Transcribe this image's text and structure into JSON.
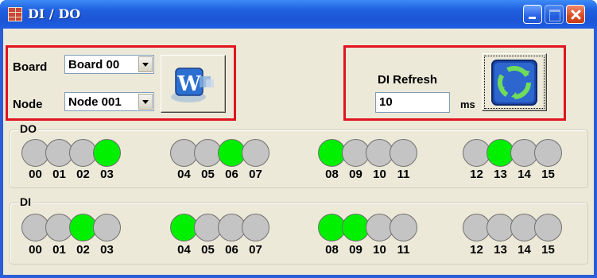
{
  "window": {
    "title": "DI / DO"
  },
  "board": {
    "label": "Board",
    "value": "Board 00"
  },
  "node": {
    "label": "Node",
    "value": "Node 001"
  },
  "refresh": {
    "label": "DI Refresh",
    "value": "10",
    "unit": "ms"
  },
  "do_group": {
    "title": "DO",
    "channels": [
      {
        "label": "00",
        "on": false
      },
      {
        "label": "01",
        "on": false
      },
      {
        "label": "02",
        "on": false
      },
      {
        "label": "03",
        "on": true
      },
      {
        "label": "04",
        "on": false
      },
      {
        "label": "05",
        "on": false
      },
      {
        "label": "06",
        "on": true
      },
      {
        "label": "07",
        "on": false
      },
      {
        "label": "08",
        "on": true
      },
      {
        "label": "09",
        "on": false
      },
      {
        "label": "10",
        "on": false
      },
      {
        "label": "11",
        "on": false
      },
      {
        "label": "12",
        "on": false
      },
      {
        "label": "13",
        "on": true
      },
      {
        "label": "14",
        "on": false
      },
      {
        "label": "15",
        "on": false
      }
    ]
  },
  "di_group": {
    "title": "DI",
    "channels": [
      {
        "label": "00",
        "on": false
      },
      {
        "label": "01",
        "on": false
      },
      {
        "label": "02",
        "on": true
      },
      {
        "label": "03",
        "on": false
      },
      {
        "label": "04",
        "on": true
      },
      {
        "label": "05",
        "on": false
      },
      {
        "label": "06",
        "on": false
      },
      {
        "label": "07",
        "on": false
      },
      {
        "label": "08",
        "on": true
      },
      {
        "label": "09",
        "on": true
      },
      {
        "label": "10",
        "on": false
      },
      {
        "label": "11",
        "on": false
      },
      {
        "label": "12",
        "on": false
      },
      {
        "label": "13",
        "on": false
      },
      {
        "label": "14",
        "on": false
      },
      {
        "label": "15",
        "on": false
      }
    ]
  },
  "colors": {
    "led_on": "#00f000",
    "led_off": "#c4c4c4",
    "highlight_box": "#e0141e"
  },
  "icons": {
    "app": "app-icon",
    "write_button": "write-icon",
    "refresh_button": "recycle-icon"
  }
}
